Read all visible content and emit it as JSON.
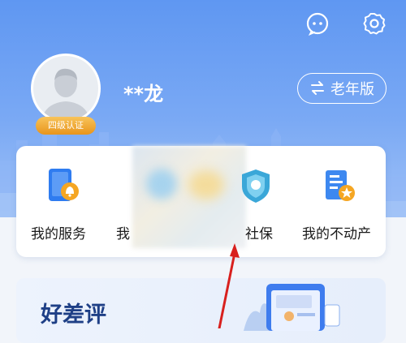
{
  "header": {
    "username": "**龙",
    "badge": "四级认证",
    "elder_mode_label": "老年版"
  },
  "services": [
    {
      "label": "我的服务",
      "icon": "bell-service-icon"
    },
    {
      "label": "我",
      "icon": "blurred-icon"
    },
    {
      "label": "社保",
      "icon": "social-security-icon"
    },
    {
      "label": "我的不动产",
      "icon": "property-icon"
    }
  ],
  "section": {
    "title": "好差评"
  },
  "colors": {
    "primary": "#5f97f2",
    "badge": "#e8951c",
    "section_title": "#1e3f86",
    "annotation": "#d8201e"
  }
}
